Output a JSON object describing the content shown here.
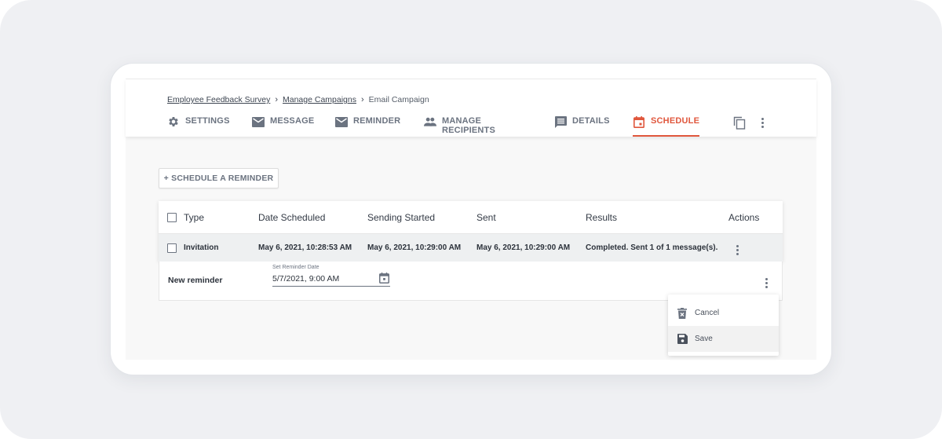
{
  "breadcrumb": {
    "items": [
      {
        "label": "Employee Feedback Survey",
        "link": true
      },
      {
        "label": "Manage Campaigns",
        "link": true
      },
      {
        "label": "Email Campaign",
        "link": false
      }
    ]
  },
  "tabs": [
    {
      "label": "SETTINGS",
      "icon": "gear-icon",
      "active": false
    },
    {
      "label": "MESSAGE",
      "icon": "envelope-icon",
      "active": false
    },
    {
      "label": "REMINDER",
      "icon": "envelope-icon",
      "active": false
    },
    {
      "label": "MANAGE RECIPIENTS",
      "icon": "people-icon",
      "active": false
    },
    {
      "label": "DETAILS",
      "icon": "comment-list-icon",
      "active": false
    },
    {
      "label": "SCHEDULE",
      "icon": "calendar-icon",
      "active": true
    }
  ],
  "header_actions": {
    "copy": "copy-icon",
    "more": "more-vertical-icon"
  },
  "colors": {
    "accent": "#e0573d",
    "text": "#333a45",
    "muted": "#6b7380",
    "row_highlight": "#eef0f1",
    "background": "#eff0f3"
  },
  "schedule_button": {
    "label": "+ SCHEDULE A REMINDER"
  },
  "table": {
    "columns": [
      "Type",
      "Date Scheduled",
      "Sending Started",
      "Sent",
      "Results",
      "Actions"
    ],
    "rows": [
      {
        "type": "Invitation",
        "date_scheduled": "May 6, 2021, 10:28:53 AM",
        "sending_started": "May 6, 2021, 10:29:00 AM",
        "sent": "May 6, 2021, 10:29:00 AM",
        "results": "Completed. Sent 1 of 1 message(s)."
      }
    ]
  },
  "new_reminder": {
    "label": "New reminder",
    "date_field_label": "Set Reminder Date",
    "date_value": "5/7/2021, 9:00 AM"
  },
  "action_menu": {
    "items": [
      {
        "label": "Cancel",
        "icon": "trash-icon"
      },
      {
        "label": "Save",
        "icon": "save-icon"
      }
    ]
  }
}
